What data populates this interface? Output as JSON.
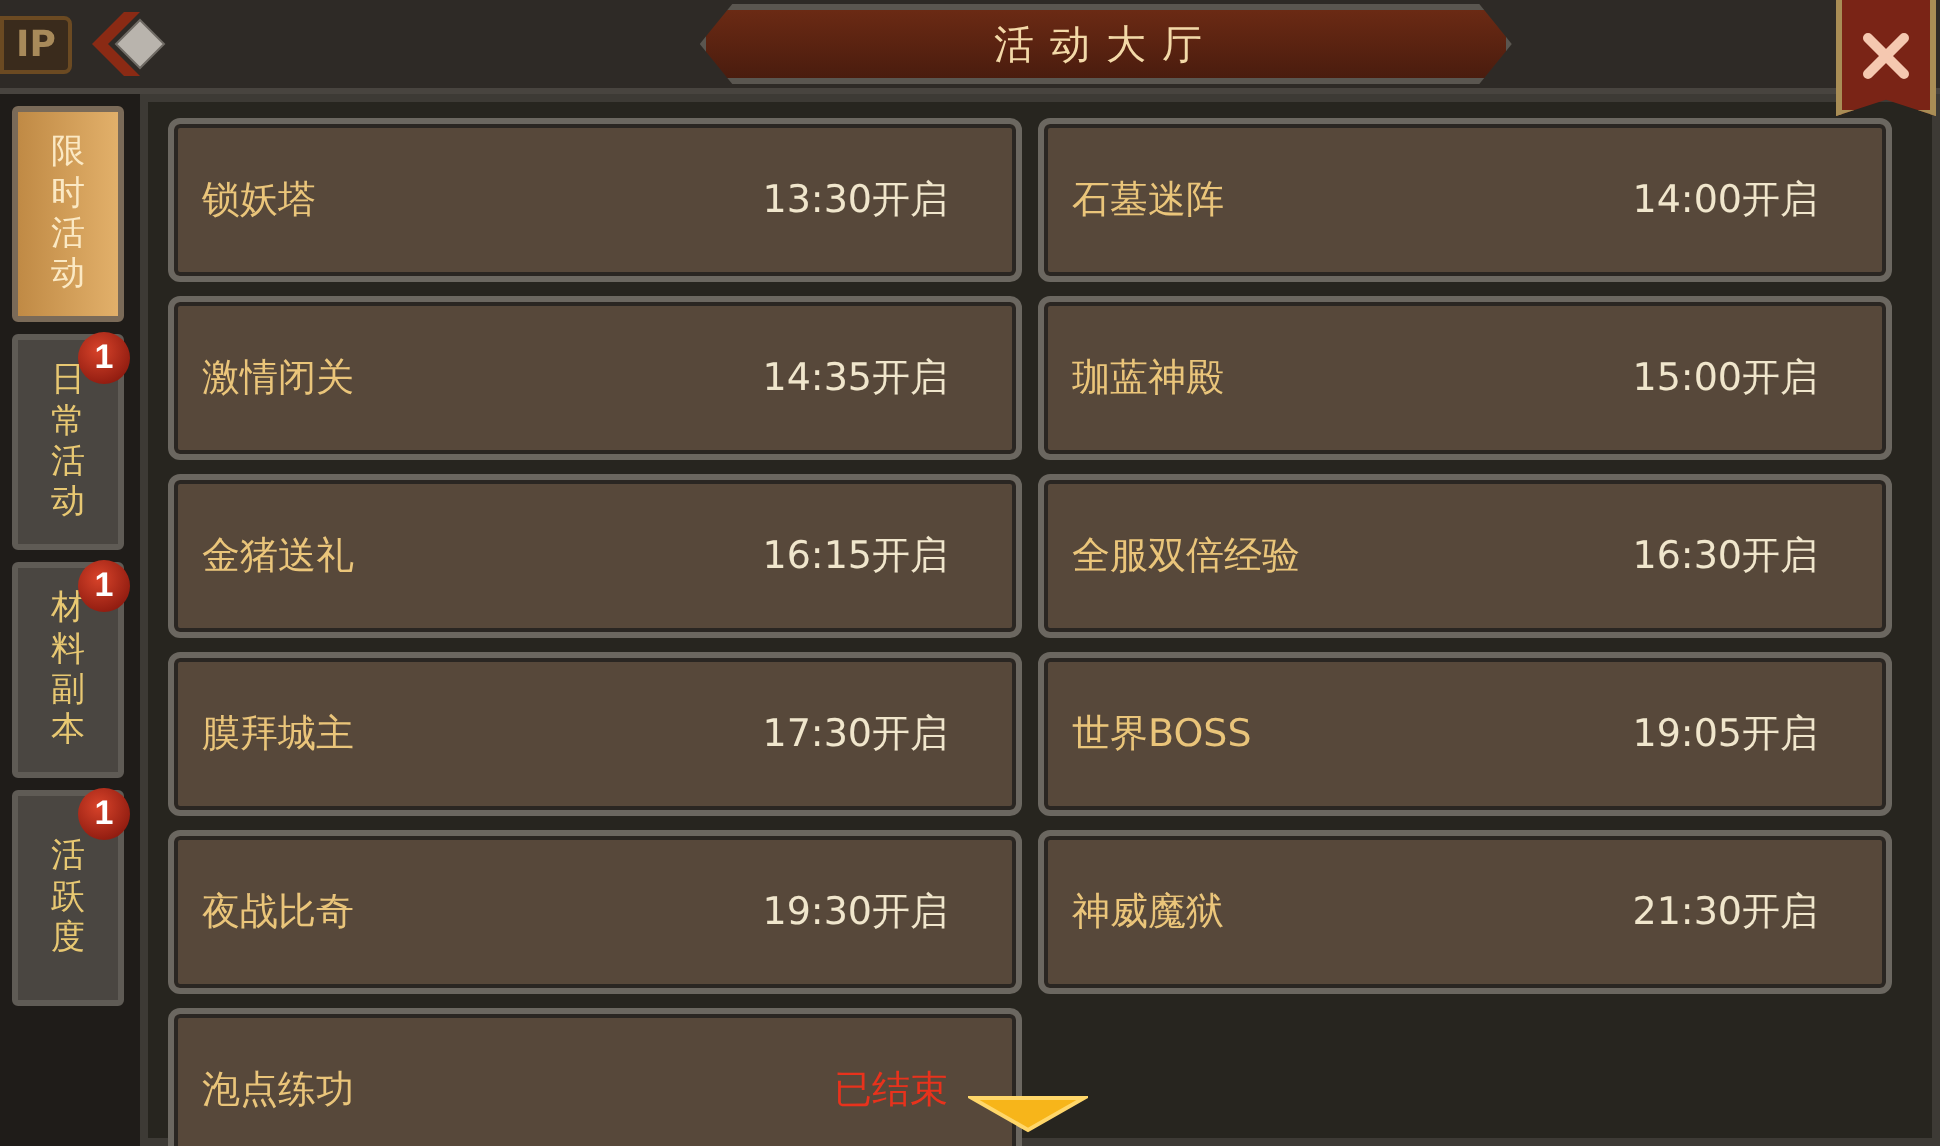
{
  "window": {
    "title": "活动大厅"
  },
  "vip_tag": "IP",
  "tabs": [
    {
      "label": "限时活动",
      "selected": true
    },
    {
      "label": "日常活动",
      "selected": false,
      "badge": "1"
    },
    {
      "label": "材料副本",
      "selected": false,
      "badge": "1"
    },
    {
      "label": "活跃度",
      "selected": false,
      "badge": "1"
    }
  ],
  "activities": [
    {
      "name": "锁妖塔",
      "time": "13:30开启",
      "kind": "upcoming"
    },
    {
      "name": "石墓迷阵",
      "time": "14:00开启",
      "kind": "upcoming"
    },
    {
      "name": "激情闭关",
      "time": "14:35开启",
      "kind": "upcoming"
    },
    {
      "name": "珈蓝神殿",
      "time": "15:00开启",
      "kind": "upcoming"
    },
    {
      "name": "金猪送礼",
      "time": "16:15开启",
      "kind": "upcoming"
    },
    {
      "name": "全服双倍经验",
      "time": "16:30开启",
      "kind": "upcoming"
    },
    {
      "name": "膜拜城主",
      "time": "17:30开启",
      "kind": "upcoming"
    },
    {
      "name": "世界BOSS",
      "time": "19:05开启",
      "kind": "upcoming"
    },
    {
      "name": "夜战比奇",
      "time": "19:30开启",
      "kind": "upcoming"
    },
    {
      "name": "神威魔狱",
      "time": "21:30开启",
      "kind": "upcoming"
    },
    {
      "name": "泡点练功",
      "time": "已结束",
      "kind": "ended"
    }
  ]
}
